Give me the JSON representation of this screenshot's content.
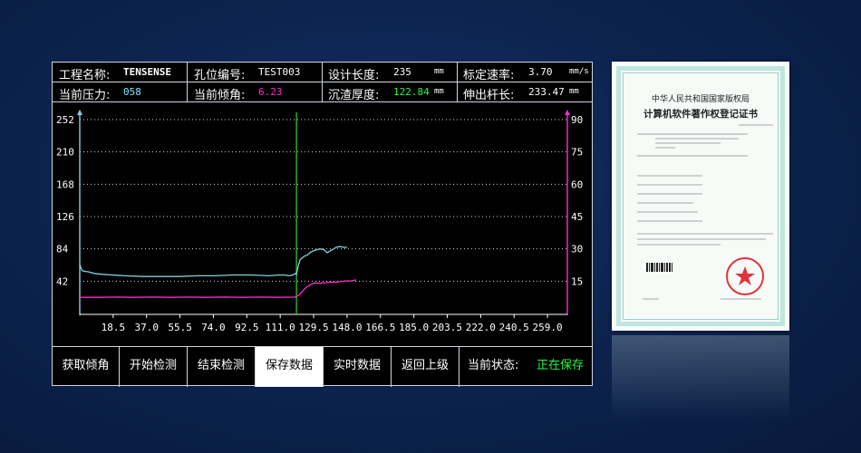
{
  "header": {
    "row1": {
      "project_label": "工程名称:",
      "project_value": "TENSENSE",
      "hole_label": "孔位编号:",
      "hole_value": "TEST003",
      "design_label": "设计长度:",
      "design_value": "235",
      "design_unit": "mm",
      "rate_label": "标定速率:",
      "rate_value": "3.70",
      "rate_unit": "mm/s"
    },
    "row2": {
      "pressure_label": "当前压力:",
      "pressure_value": "058",
      "tilt_label": "当前倾角:",
      "tilt_value": "6.23",
      "sediment_label": "沉渣厚度:",
      "sediment_value": "122.84",
      "sediment_unit": "mm",
      "extend_label": "伸出杆长:",
      "extend_value": "233.47",
      "extend_unit": "mm"
    }
  },
  "chart_data": {
    "type": "line",
    "x_ticks": [
      "18.5",
      "37.0",
      "55.5",
      "74.0",
      "92.5",
      "111.0",
      "129.5",
      "148.0",
      "166.5",
      "185.0",
      "203.5",
      "222.0",
      "240.5",
      "259.0"
    ],
    "y_left_ticks": [
      "252",
      "210",
      "168",
      "126",
      "84",
      "42"
    ],
    "y_right_ticks": [
      "90",
      "75",
      "60",
      "45",
      "30",
      "15"
    ],
    "grid": true,
    "marker_x": 120,
    "series": [
      {
        "axis": "left",
        "color": "#7fd3e0",
        "x": [
          0,
          1,
          2,
          5,
          8,
          12,
          18,
          25,
          35,
          45,
          55,
          65,
          75,
          85,
          95,
          105,
          110,
          113,
          116,
          118,
          119.5,
          120,
          121,
          122,
          124,
          126,
          128,
          130,
          133,
          135,
          137,
          140,
          142,
          144,
          146,
          148
        ],
        "y": [
          64,
          57,
          55,
          54,
          52,
          51,
          50,
          49,
          48,
          48,
          48,
          49,
          49,
          50,
          50,
          49,
          50,
          50,
          49,
          50,
          52,
          51,
          62,
          70,
          74,
          76,
          80,
          82,
          84,
          83,
          79,
          83,
          86,
          87,
          86,
          86
        ]
      },
      {
        "axis": "right",
        "color": "#ff2bd2",
        "x": [
          0,
          10,
          20,
          30,
          40,
          50,
          60,
          70,
          80,
          90,
          100,
          110,
          119,
          120,
          122,
          124,
          126,
          128,
          130,
          133,
          136,
          139,
          142,
          145,
          148,
          150,
          153
        ],
        "y": [
          7.5,
          7.5,
          7.6,
          7.5,
          7.6,
          7.5,
          7.6,
          7.5,
          7.6,
          7.5,
          7.6,
          7.5,
          7.6,
          7.8,
          9,
          11,
          12.5,
          13.5,
          14.2,
          14.0,
          14.3,
          14.6,
          14.5,
          14.9,
          15.2,
          15.1,
          15.6
        ]
      }
    ]
  },
  "buttons": {
    "get_tilt": "获取倾角",
    "start": "开始检测",
    "end": "结束检测",
    "save": "保存数据",
    "realtime": "实时数据",
    "back": "返回上级",
    "status_label": "当前状态:",
    "status_value": "正在保存"
  },
  "certificate": {
    "title1": "中华人民共和国国家版权局",
    "title2": "计算机软件著作权登记证书"
  }
}
